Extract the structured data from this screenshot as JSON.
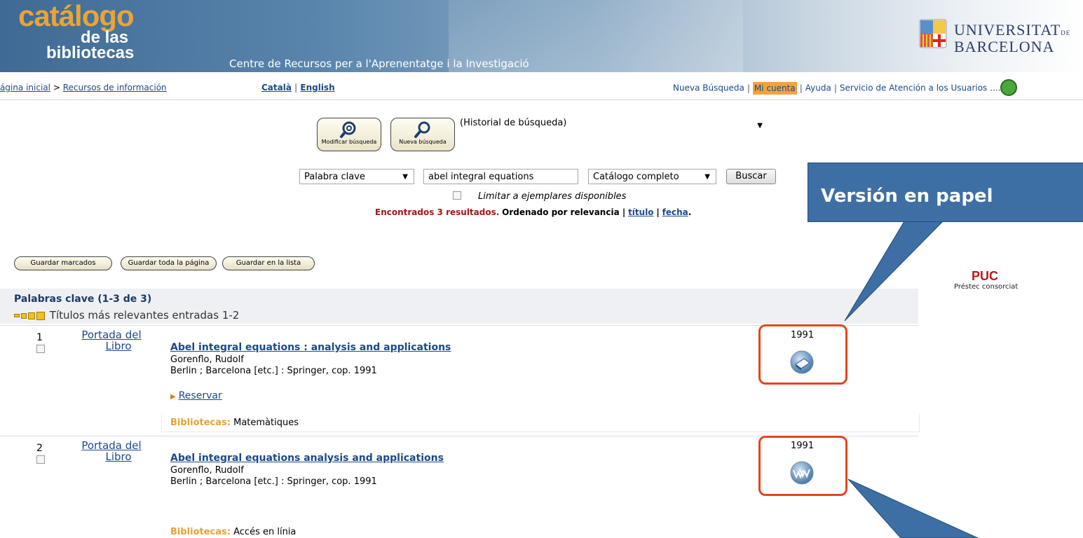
{
  "header": {
    "logo_line1": "catálogo",
    "logo_line2": "de las",
    "logo_line3": "bibliotecas",
    "subtitle": "Centre de Recursos per a l'Aprenentatge i la Investigació",
    "university_line1": "UNIVERSITAT",
    "university_line1_small": "DE",
    "university_line2": "BARCELONA"
  },
  "nav": {
    "breadcrumb_home": "ágina inicial",
    "breadcrumb_sep": ">",
    "breadcrumb_resources": "Recursos de información",
    "lang_catala": "Català",
    "lang_sep": "|",
    "lang_english": "English",
    "nueva_busqueda": "Nueva Búsqueda",
    "mi_cuenta": "Mi cuenta",
    "ayuda": "Ayuda",
    "servicio": "Servicio de Atención a los Usuarios",
    "ellipsis": "...."
  },
  "toolbar": {
    "modify_label": "Modificar búsqueda",
    "new_label": "Nueva búsqueda",
    "history_value": "(Historial de búsqueda)"
  },
  "search": {
    "field_type": "Palabra clave",
    "query": "abel integral equations",
    "scope": "Catálogo completo",
    "button": "Buscar",
    "limit_label": "Limitar a ejemplares disponibles",
    "found_text": "Encontrados 3 resultados.",
    "sort_text": "Ordenado por relevancia |",
    "sort_title": "título",
    "sort_sep": "|",
    "sort_date": "fecha",
    "sort_end": "."
  },
  "actions": {
    "save_marked": "Guardar marcados",
    "save_page": "Guardar toda la página",
    "save_list": "Guardar en la lista"
  },
  "puc": {
    "title": "PUC",
    "subtitle": "Préstec consorciat"
  },
  "results": {
    "heading": "Palabras clave (1-3 de 3)",
    "relevance": "Títulos más relevantes entradas 1-2",
    "items": [
      {
        "num": "1",
        "cover_line1": "Portada del",
        "cover_line2": "Libro",
        "title": "Abel integral equations : analysis and applications",
        "author": "Gorenflo, Rudolf",
        "imprint": "Berlin ; Barcelona [etc.] : Springer, cop. 1991",
        "reserve": "Reservar",
        "libraries_label": "Bibliotecas:",
        "libraries": "Matemàtiques",
        "year": "1991",
        "icon": "book-icon"
      },
      {
        "num": "2",
        "cover_line1": "Portada del",
        "cover_line2": "Libro",
        "title": "Abel integral equations analysis and applications",
        "author": "Gorenflo, Rudolf",
        "imprint": "Berlin ; Barcelona [etc.] : Springer, cop. 1991",
        "libraries_label": "Bibliotecas:",
        "libraries": "Accés en línia",
        "year": "1991",
        "icon": "www-icon"
      }
    ]
  },
  "callout": {
    "text": "Versión en papel"
  },
  "colors": {
    "highlight_box": "#e5451c",
    "callout": "#3d6fa5",
    "link": "#1a4a8a",
    "libraries_label": "#e2a33a"
  }
}
